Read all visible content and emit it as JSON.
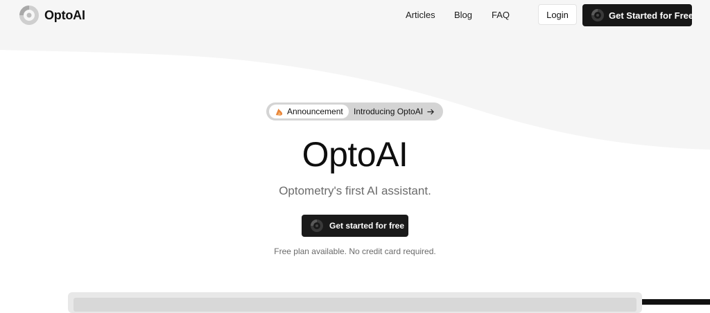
{
  "header": {
    "brand": "OptoAI",
    "nav": [
      {
        "label": "Articles"
      },
      {
        "label": "Blog"
      },
      {
        "label": "FAQ"
      }
    ],
    "login_label": "Login",
    "cta_label": "Get Started for Free"
  },
  "announcement": {
    "tag_label": "Announcement",
    "text": "Introducing OptoAI",
    "tag_icon": "flame-icon",
    "arrow_icon": "arrow-right-icon"
  },
  "hero": {
    "title": "OptoAI",
    "subtitle": "Optometry's first AI assistant.",
    "cta_label": "Get started for free",
    "note": "Free plan available. No credit card required."
  },
  "colors": {
    "header_bg": "#f6f6f6",
    "button_dark": "#171717",
    "pill_bg": "#d4d4d4",
    "flame": "#e8853a",
    "wave": "#f5f5f5"
  }
}
